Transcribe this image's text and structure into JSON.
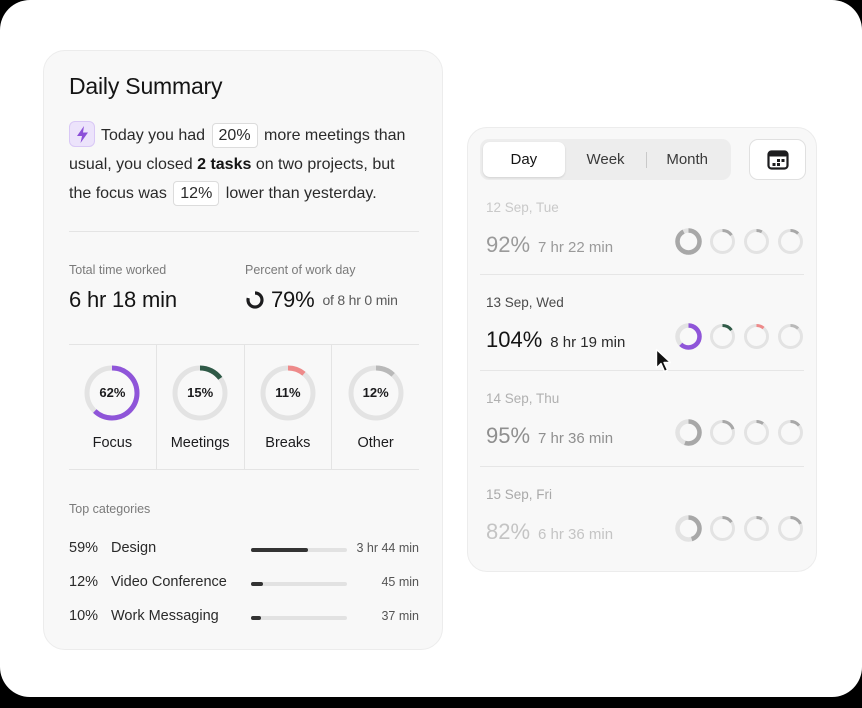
{
  "summary": {
    "title": "Daily Summary",
    "text": {
      "part1": "Today you had",
      "chip1": "20%",
      "part2": "more meetings than usual, you closed",
      "bold": "2 tasks",
      "part3": "on two projects, but the focus was",
      "chip2": "12%",
      "part4": "lower than yesterday."
    },
    "total_time": {
      "label": "Total time worked",
      "value": "6 hr 18 min"
    },
    "percent_day": {
      "label": "Percent of work day",
      "value": "79%",
      "sub": "of 8 hr 0 min",
      "fraction": 0.79
    },
    "rings": [
      {
        "name": "Focus",
        "pct": "62%",
        "fraction": 0.62,
        "color": "#8f55d9"
      },
      {
        "name": "Meetings",
        "pct": "15%",
        "fraction": 0.15,
        "color": "#2f5a47"
      },
      {
        "name": "Breaks",
        "pct": "11%",
        "fraction": 0.11,
        "color": "#ee8a8a"
      },
      {
        "name": "Other",
        "pct": "12%",
        "fraction": 0.12,
        "color": "#b9b9b9"
      }
    ],
    "top_categories": {
      "title": "Top categories",
      "items": [
        {
          "pct": "59%",
          "name": "Design",
          "time": "3 hr 44 min",
          "fraction": 0.59
        },
        {
          "pct": "12%",
          "name": "Video Conference",
          "time": "45 min",
          "fraction": 0.12
        },
        {
          "pct": "10%",
          "name": "Work Messaging",
          "time": "37 min",
          "fraction": 0.1
        }
      ]
    }
  },
  "day_panel": {
    "tabs": [
      "Day",
      "Week",
      "Month"
    ],
    "active_tab": "Day",
    "calendar_icon": "calendar-icon",
    "days": [
      {
        "date": "12 Sep, Tue",
        "pct": "92%",
        "duration": "7 hr 22 min",
        "state": "faded",
        "rings": [
          0.92,
          0.15,
          0.08,
          0.12
        ]
      },
      {
        "date": "13 Sep, Wed",
        "pct": "104%",
        "duration": "8 hr 19 min",
        "state": "active",
        "rings": [
          0.62,
          0.15,
          0.11,
          0.12
        ]
      },
      {
        "date": "14 Sep, Thu",
        "pct": "95%",
        "duration": "7 hr 36 min",
        "state": "faded2",
        "rings": [
          0.55,
          0.2,
          0.1,
          0.14
        ]
      },
      {
        "date": "15 Sep, Fri",
        "pct": "82%",
        "duration": "6 hr 36 min",
        "state": "faded3",
        "rings": [
          0.45,
          0.15,
          0.08,
          0.18
        ]
      }
    ],
    "ring_colors": {
      "focus": "#8f55d9",
      "meetings": "#2f5a47",
      "breaks": "#ee8a8a",
      "other": "#b9b9b9",
      "track": "#e3e3e3"
    }
  }
}
